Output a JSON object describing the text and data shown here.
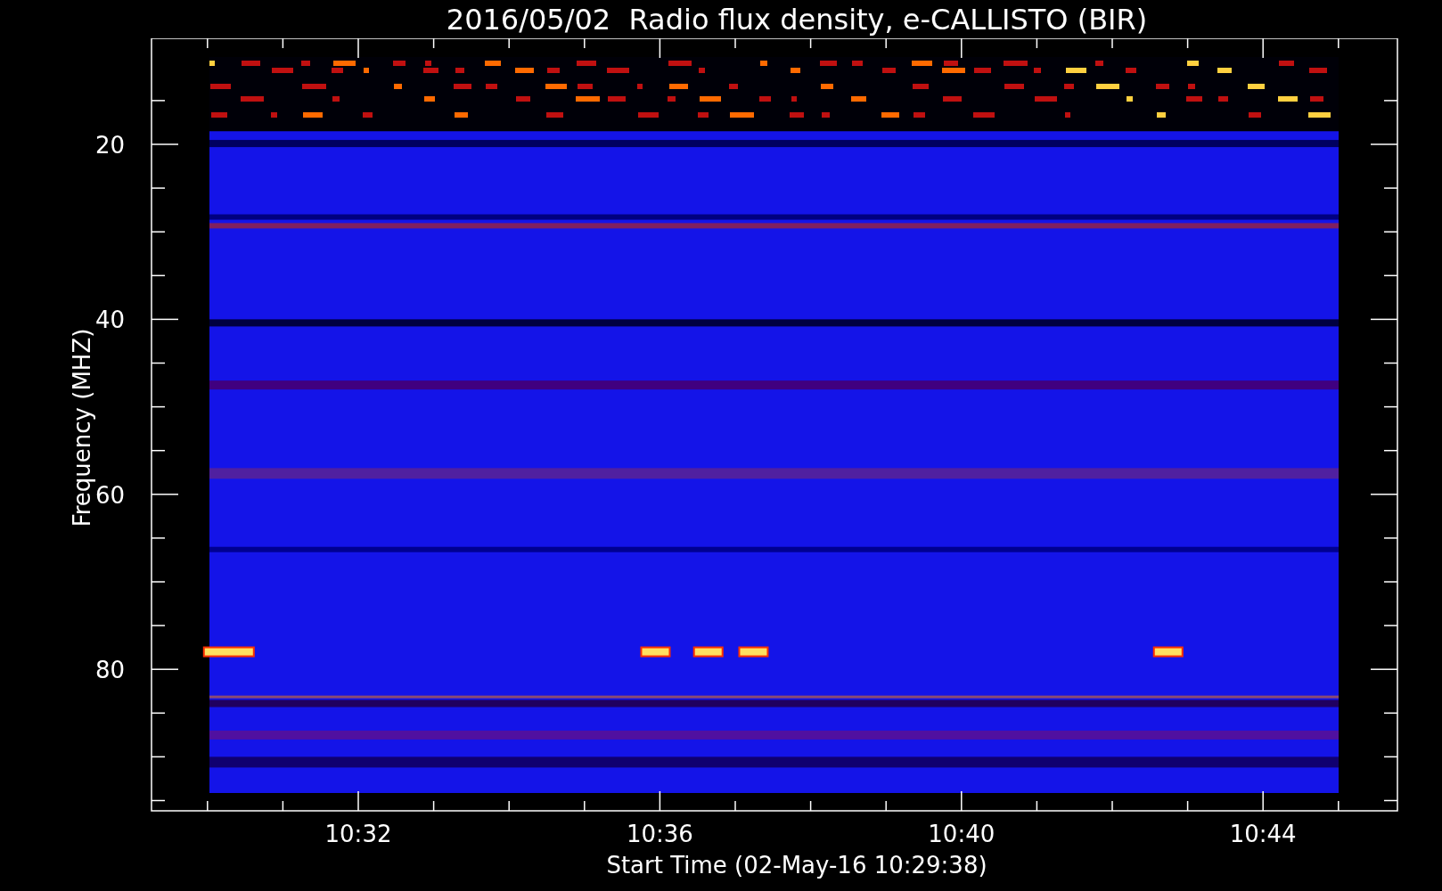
{
  "title": "2016/05/02  Radio flux density, e-CALLISTO (BIR)",
  "y_axis": {
    "label": "Frequency (MHZ)",
    "ticks": [
      "20",
      "40",
      "60",
      "80"
    ]
  },
  "x_axis": {
    "label": "Start Time (02-May-16 10:29:38)",
    "ticks": [
      "10:32",
      "10:36",
      "10:40",
      "10:44"
    ]
  }
}
